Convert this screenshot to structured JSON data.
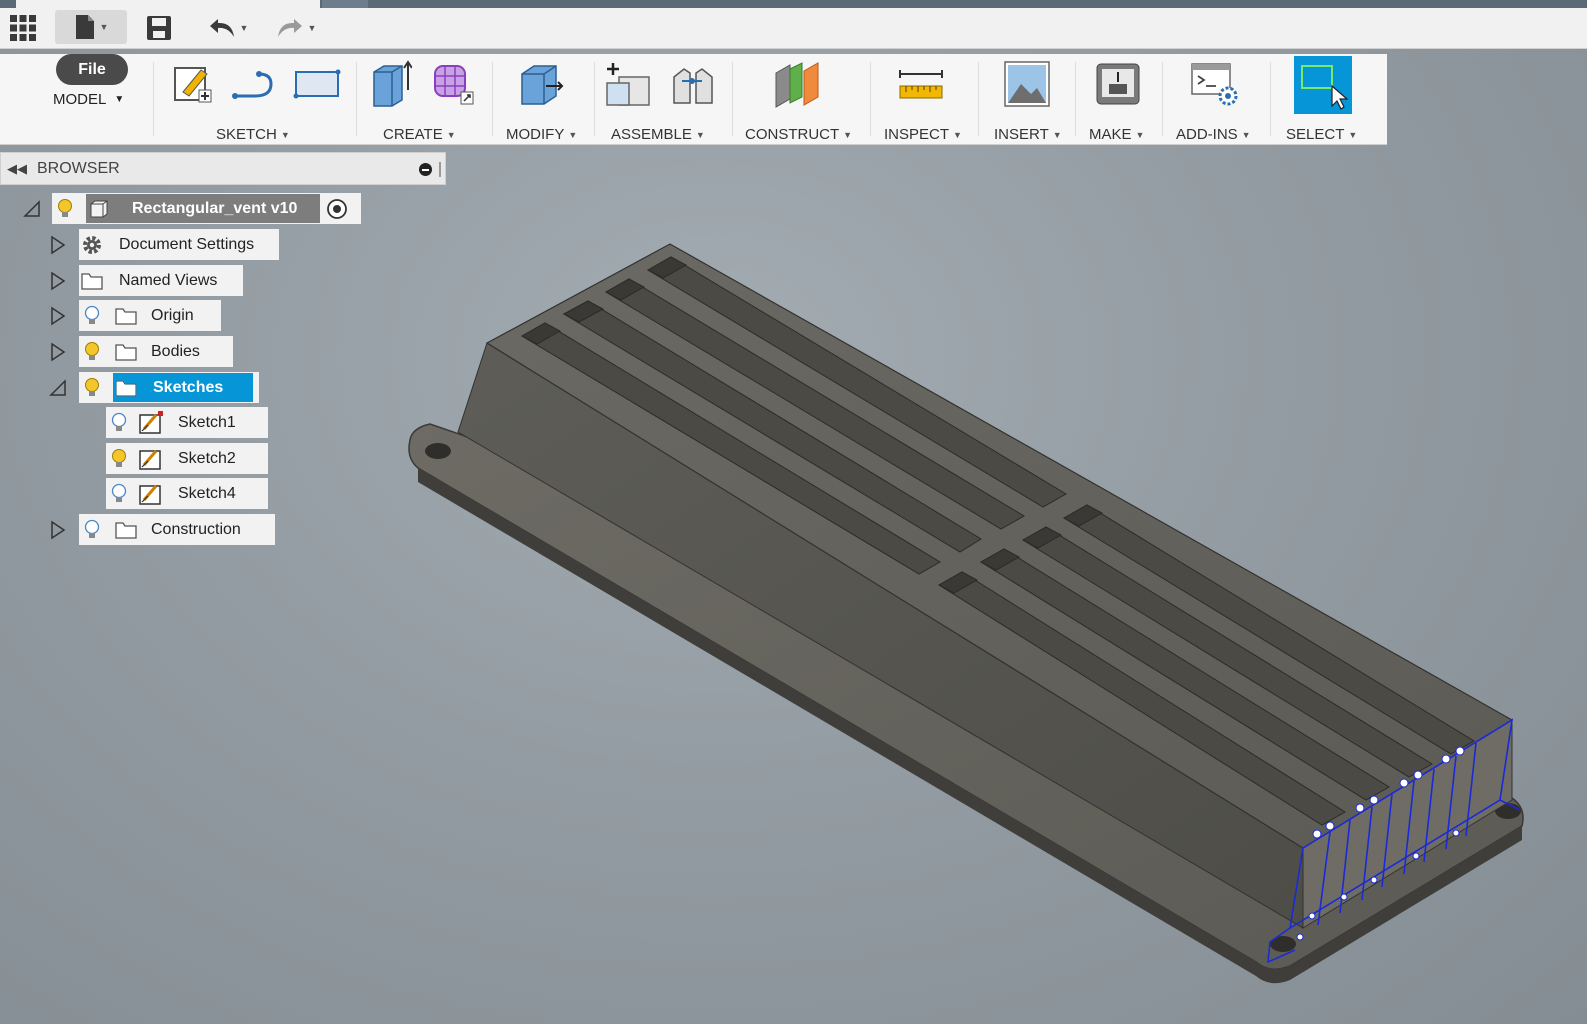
{
  "quick_access": {
    "apps_icon": "grid-icon",
    "file_icon": "file-icon",
    "save_icon": "save-icon",
    "undo_icon": "undo-icon",
    "redo_icon": "redo-icon"
  },
  "ribbon": {
    "file_label": "File",
    "workspace_label": "MODEL",
    "groups": [
      {
        "label": "SKETCH",
        "icons": [
          "create-sketch-icon",
          "line-icon",
          "rectangle-icon"
        ]
      },
      {
        "label": "CREATE",
        "icons": [
          "extrude-icon",
          "form-icon"
        ]
      },
      {
        "label": "MODIFY",
        "icons": [
          "press-pull-icon"
        ]
      },
      {
        "label": "ASSEMBLE",
        "icons": [
          "new-component-icon",
          "joint-icon"
        ]
      },
      {
        "label": "CONSTRUCT",
        "icons": [
          "plane-icon"
        ]
      },
      {
        "label": "INSPECT",
        "icons": [
          "measure-icon"
        ]
      },
      {
        "label": "INSERT",
        "icons": [
          "insert-image-icon"
        ]
      },
      {
        "label": "MAKE",
        "icons": [
          "print-3d-icon"
        ]
      },
      {
        "label": "ADD-INS",
        "icons": [
          "scripts-icon"
        ]
      },
      {
        "label": "SELECT",
        "icons": [
          "select-icon"
        ]
      }
    ]
  },
  "browser": {
    "title": "BROWSER",
    "root": {
      "label": "Rectangular_vent v10"
    },
    "nodes": [
      {
        "label": "Document Settings",
        "icon": "gear-icon"
      },
      {
        "label": "Named Views",
        "icon": "folder-icon"
      },
      {
        "label": "Origin",
        "icon": "folder-icon",
        "visible": false
      },
      {
        "label": "Bodies",
        "icon": "folder-icon",
        "visible": true
      },
      {
        "label": "Sketches",
        "icon": "folder-icon",
        "visible": true,
        "selected": true
      },
      {
        "label": "Sketch1",
        "icon": "sketch-icon",
        "visible": false
      },
      {
        "label": "Sketch2",
        "icon": "sketch-icon",
        "visible": true
      },
      {
        "label": "Sketch4",
        "icon": "sketch-icon",
        "visible": false
      },
      {
        "label": "Construction",
        "icon": "folder-icon",
        "visible": false
      }
    ]
  },
  "colors": {
    "selection_blue": "#0696d7",
    "model_gray": "#5f5e58",
    "sketch_blue": "#1a2bd6",
    "bulb_on": "#f3c62a"
  }
}
